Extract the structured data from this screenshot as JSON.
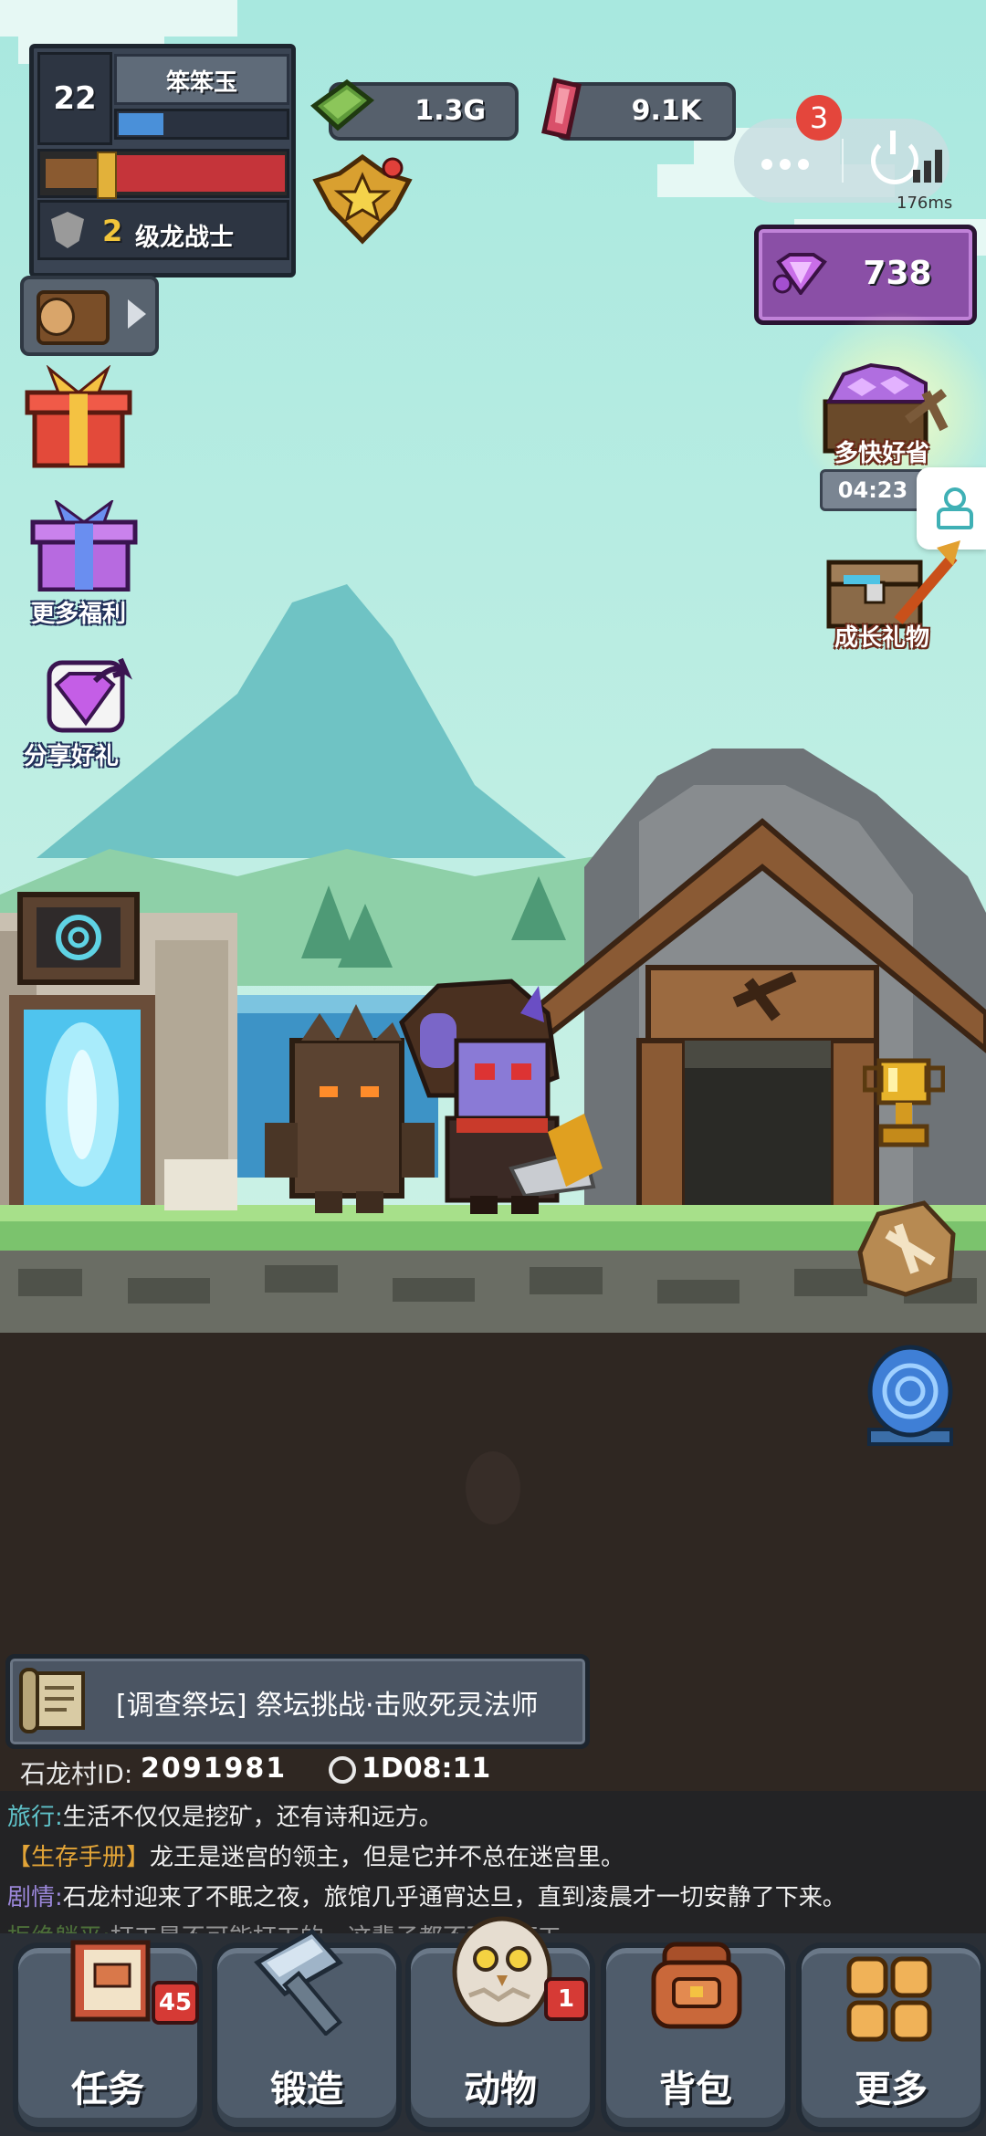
{
  "player": {
    "level": "22",
    "name": "笨笨玉",
    "rank_num": "2",
    "rank_title": "级龙战士",
    "exp_fraction": 0.27,
    "hp_fraction": 0.78
  },
  "resources": {
    "cash": "1.3G",
    "crystal": "9.1K",
    "gems": "738"
  },
  "miniapp": {
    "notification_count": "3",
    "latency": "176ms"
  },
  "left_menu": {
    "more_welfare": "更多福利",
    "share_gift": "分享好礼"
  },
  "right_menu": {
    "offer_label": "多快好省",
    "offer_timer": "04:23",
    "growth_gift": "成长礼物"
  },
  "quest": {
    "text": "[调查祭坛] 祭坛挑战·击败死灵法师"
  },
  "village": {
    "id_label": "石龙村ID:",
    "id_value": "2091981",
    "timer": "1D08:11"
  },
  "log": [
    {
      "tag": "旅行:",
      "tag_color": "#5fc2c9",
      "text": "生活不仅仅是挖矿，还有诗和远方。"
    },
    {
      "tag": "【生存手册】",
      "tag_color": "#e2a437",
      "text": "龙王是迷宫的领主，但是它并不总在迷宫里。"
    },
    {
      "tag": "剧情:",
      "tag_color": "#9a86d8",
      "text": "石龙村迎来了不眠之夜，旅馆几乎通宵达旦，直到凌晨才一切安静了下来。"
    },
    {
      "tag": "拒绝躺平:",
      "tag_color": "#6fae4a",
      "text": "打工是不可能打工的，这辈子都不可能打工。"
    }
  ],
  "nav": {
    "tasks": "任务",
    "tasks_badge": "45",
    "forge": "锻造",
    "animals": "动物",
    "animals_badge": "1",
    "bag": "背包",
    "more": "更多"
  }
}
